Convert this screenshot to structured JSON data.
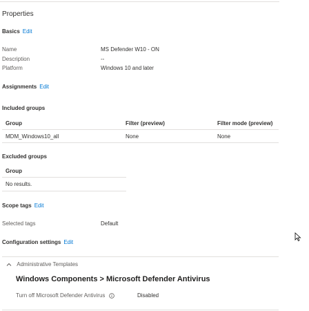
{
  "page": {
    "title": "Properties"
  },
  "basics": {
    "heading": "Basics",
    "edit": "Edit",
    "fields": [
      {
        "label": "Name",
        "value": "MS Defender W10 - ON"
      },
      {
        "label": "Description",
        "value": "--"
      },
      {
        "label": "Platform",
        "value": "Windows 10 and later"
      }
    ]
  },
  "assignments": {
    "heading": "Assignments",
    "edit": "Edit",
    "included": {
      "heading": "Included groups",
      "columns": [
        "Group",
        "Filter (preview)",
        "Filter mode (preview)"
      ],
      "rows": [
        [
          "MDM_Windows10_all",
          "None",
          "None"
        ]
      ]
    },
    "excluded": {
      "heading": "Excluded groups",
      "column": "Group",
      "empty": "No results."
    }
  },
  "scope": {
    "heading": "Scope tags",
    "edit": "Edit",
    "label": "Selected tags",
    "value": "Default"
  },
  "config": {
    "heading": "Configuration settings",
    "edit": "Edit",
    "category": "Administrative Templates",
    "subtitle": "Windows Components > Microsoft Defender Antivirus",
    "setting": {
      "label": "Turn off Microsoft Defender Antivirus",
      "value": "Disabled"
    }
  }
}
